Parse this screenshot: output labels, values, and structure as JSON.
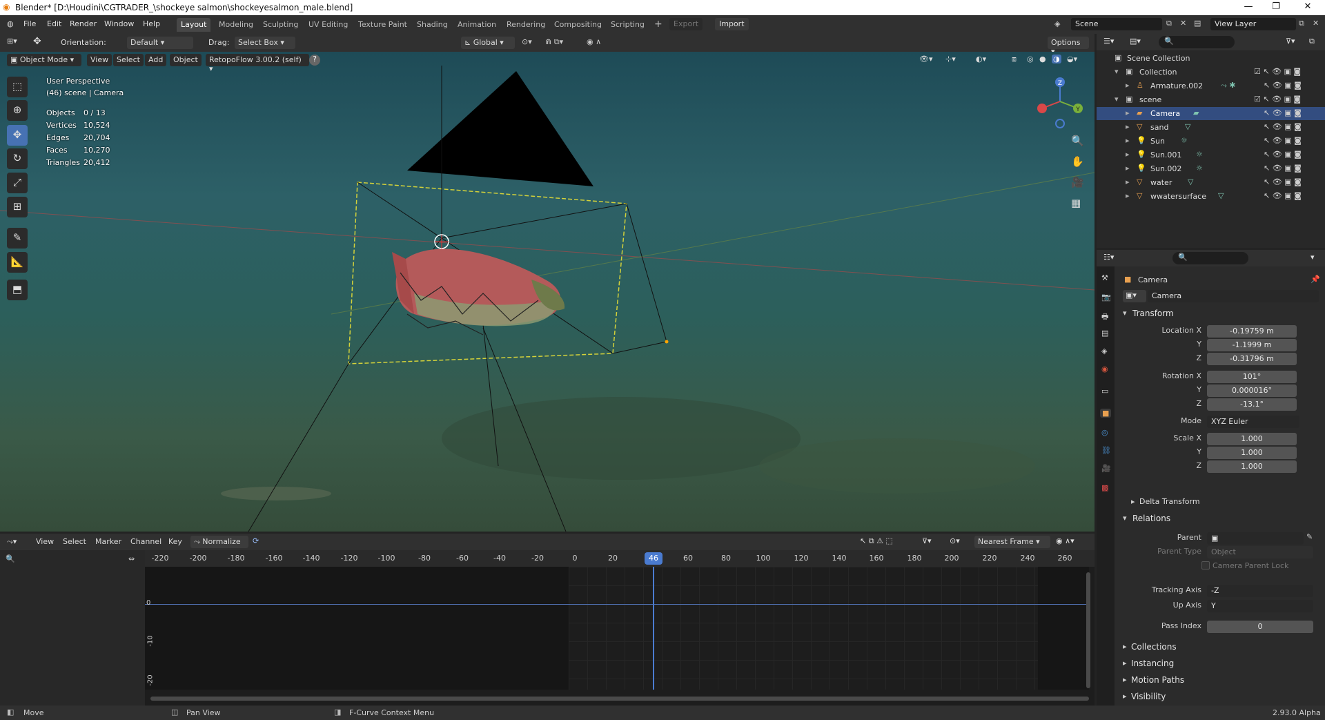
{
  "window": {
    "title": "Blender* [D:\\Houdini\\CGTRADER_\\shockeye salmon\\shockeyesalmon_male.blend]",
    "minimize": "—",
    "maximize": "❐",
    "close": "✕"
  },
  "menu": [
    "File",
    "Edit",
    "Render",
    "Window",
    "Help"
  ],
  "workspaces": [
    "Layout",
    "Modeling",
    "Sculpting",
    "UV Editing",
    "Texture Paint",
    "Shading",
    "Animation",
    "Rendering",
    "Compositing",
    "Scripting"
  ],
  "export_label": "Export",
  "import_label": "Import",
  "scene_name": "Scene",
  "view_layer": "View Layer",
  "viewport_header": {
    "orientation_label": "Orientation:",
    "orientation_value": "Default",
    "drag_label": "Drag:",
    "drag_value": "Select Box",
    "transform_space": "Global",
    "options": "Options"
  },
  "viewport_header2": {
    "mode": "Object Mode",
    "view": "View",
    "select": "Select",
    "add": "Add",
    "object": "Object",
    "addon": "RetopoFlow 3.00.2 (self)"
  },
  "viewport_info": {
    "perspective": "User Perspective",
    "context": "(46) scene | Camera",
    "stats": [
      {
        "label": "Objects",
        "value": "0 / 13"
      },
      {
        "label": "Vertices",
        "value": "10,524"
      },
      {
        "label": "Edges",
        "value": "20,704"
      },
      {
        "label": "Faces",
        "value": "10,270"
      },
      {
        "label": "Triangles",
        "value": "20,412"
      }
    ]
  },
  "gizmo": {
    "x": "X",
    "y": "Y",
    "z": "Z"
  },
  "timeline_header": {
    "view": "View",
    "select": "Select",
    "marker": "Marker",
    "channel": "Channel",
    "key": "Key",
    "normalize": "Normalize",
    "snap": "Nearest Frame"
  },
  "timeline": {
    "ticks": [
      "-220",
      "-200",
      "-180",
      "-160",
      "-140",
      "-120",
      "-100",
      "-80",
      "-60",
      "-40",
      "-20",
      "0",
      "20",
      "40",
      "60",
      "80",
      "100",
      "120",
      "140",
      "160",
      "180",
      "200",
      "220",
      "240",
      "260"
    ],
    "current_frame": "46",
    "y_labels": [
      "0",
      "-10",
      "-20"
    ]
  },
  "outliner": {
    "root": "Scene Collection",
    "rows": [
      {
        "name": "Collection",
        "indent": 1
      },
      {
        "name": "Armature.002",
        "indent": 2
      },
      {
        "name": "scene",
        "indent": 1
      },
      {
        "name": "Camera",
        "indent": 2,
        "selected": true
      },
      {
        "name": "sand",
        "indent": 2
      },
      {
        "name": "Sun",
        "indent": 2
      },
      {
        "name": "Sun.001",
        "indent": 2
      },
      {
        "name": "Sun.002",
        "indent": 2
      },
      {
        "name": "water",
        "indent": 2
      },
      {
        "name": "wwatersurface",
        "indent": 2
      }
    ]
  },
  "properties": {
    "object_name": "Camera",
    "data_name": "Camera",
    "transform_label": "Transform",
    "location_x_label": "Location X",
    "location_x": "-0.19759 m",
    "location_y": "-1.1999 m",
    "location_z": "-0.31796 m",
    "rotation_x_label": "Rotation X",
    "rotation_x": "101°",
    "rotation_y": "0.000016°",
    "rotation_z": "-13.1°",
    "mode_label": "Mode",
    "mode": "XYZ Euler",
    "scale_x_label": "Scale X",
    "scale_x": "1.000",
    "scale_y": "1.000",
    "scale_z": "1.000",
    "y_label": "Y",
    "z_label": "Z",
    "delta_transform": "Delta Transform",
    "relations": "Relations",
    "parent_label": "Parent",
    "parent_type_label": "Parent Type",
    "parent_type": "Object",
    "camera_parent_lock": "Camera Parent Lock",
    "tracking_axis_label": "Tracking Axis",
    "tracking_axis": "-Z",
    "up_axis_label": "Up Axis",
    "up_axis": "Y",
    "pass_index_label": "Pass Index",
    "pass_index": "0",
    "collections": "Collections",
    "instancing": "Instancing",
    "motion_paths": "Motion Paths",
    "visibility": "Visibility"
  },
  "status": {
    "move": "Move",
    "pan": "Pan View",
    "context_menu": "F-Curve Context Menu",
    "version": "2.93.0 Alpha"
  }
}
